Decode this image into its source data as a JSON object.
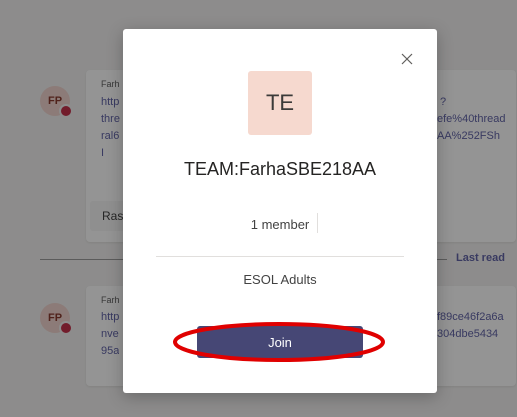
{
  "background": {
    "messages": [
      {
        "avatar_initials": "FP",
        "sender": "Farh",
        "lines_left": [
          "http",
          "thre",
          "ral6",
          "I"
        ],
        "lines_right": [
          "?",
          "efe%40thread",
          "AA%252FSh"
        ],
        "reply_text": "Ras"
      },
      {
        "avatar_initials": "FP",
        "sender": "Farh",
        "lines_left": [
          "http",
          "nve",
          "95a"
        ],
        "lines_right": [
          "f89ce46f2a6a",
          "304dbe5434"
        ]
      }
    ],
    "last_read_label": "Last read"
  },
  "modal": {
    "team_initials": "TE",
    "team_name": "TEAM:FarhaSBE218AA",
    "member_count": "1 member",
    "description": "ESOL Adults",
    "join_label": "Join",
    "close_icon": "close-icon"
  },
  "colors": {
    "join_button": "#464775",
    "team_avatar_bg": "#f6d9cf",
    "annotation": "#e00000",
    "presence_busy": "#c4314b",
    "link": "#6264a7"
  }
}
